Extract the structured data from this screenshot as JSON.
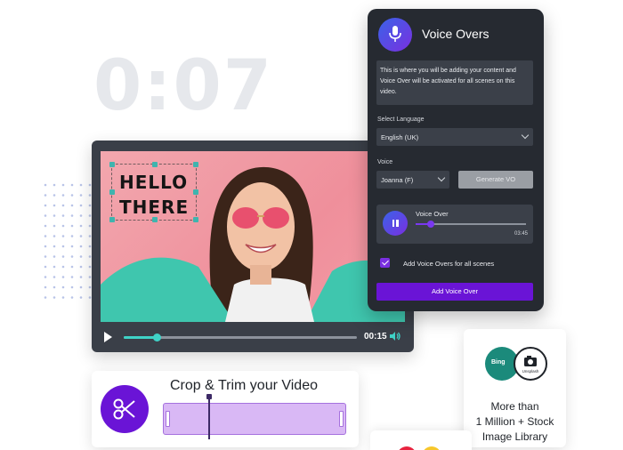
{
  "timer": {
    "value": "0:07"
  },
  "video": {
    "overlay_text": "HELLO\nTHERE",
    "current_time": "00:15",
    "progress_fraction": 0.14
  },
  "voice_over_panel": {
    "title": "Voice Overs",
    "description": "This is where you will be adding your content and Voice Over will be activated for all scenes on this video.",
    "language_label": "Select Language",
    "language_value": "English (UK)",
    "voice_label": "Voice",
    "voice_value": "Joanna (F)",
    "generate_button": "Generate VO",
    "audio": {
      "title": "Voice Over",
      "time": "03:45",
      "progress_fraction": 0.14
    },
    "checkbox_label": "Add Voice Overs for all scenes",
    "checkbox_checked": true,
    "add_button": "Add  Voice Over",
    "accent_color": "#6a14d6"
  },
  "crop_card": {
    "title": "Crop & Trim your Video"
  },
  "stock_card": {
    "bing_label": "Bing",
    "unsplash_label": "Unsplash",
    "text": "More than\n1 Million + Stock\nImage Library"
  }
}
